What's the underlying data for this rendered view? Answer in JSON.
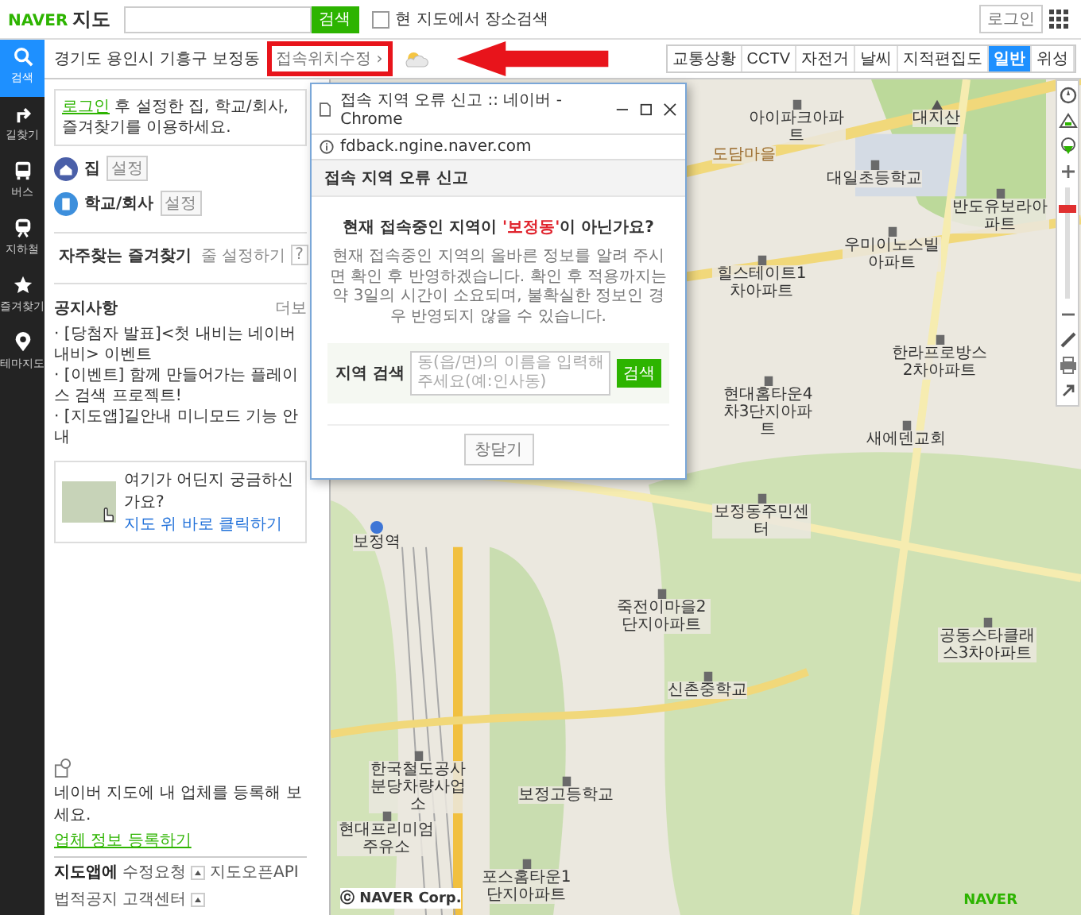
{
  "top_bar": {
    "logo_brand": "NAVER",
    "logo_product": "지도",
    "search_button": "검색",
    "area_search": {
      "label": "현 지도에서 장소검색",
      "checked": false
    },
    "login_button": "로그인"
  },
  "nav": [
    {
      "kind": "search",
      "label": "검색",
      "selected": true
    },
    {
      "kind": "route",
      "label": "길찾기",
      "selected": false
    },
    {
      "kind": "bus",
      "label": "버스",
      "selected": false
    },
    {
      "kind": "subway",
      "label": "지하철",
      "selected": false
    },
    {
      "kind": "star",
      "label": "즐겨찾기",
      "selected": false
    },
    {
      "kind": "pin",
      "label": "테마지도",
      "selected": false
    }
  ],
  "location": {
    "address": "경기도 용인시 기흥구 보정동",
    "fix_link": "접속위치수정 ›"
  },
  "login_notice": {
    "link": "로그인",
    "text": " 후 설정한 집, 학교/회사, 즐겨찾기를 이용하세요."
  },
  "places": [
    {
      "kind": "home",
      "label": "집",
      "action": "설정"
    },
    {
      "kind": "work",
      "label": "학교/회사",
      "action": "설정"
    }
  ],
  "favorites": {
    "title": "자주찾는 즐겨찾기",
    "settings": "줄 설정하기",
    "help": "?"
  },
  "notices": {
    "title": "공지사항",
    "more": "더보",
    "items": [
      "· [당첨자 발표]<첫 내비는 네이버 내비> 이벤트",
      "· [이벤트] 함께 만들어가는 플레이스 검색 프로젝트!",
      "· [지도앱]길안내 미니모드 기능 안내"
    ]
  },
  "promo": {
    "question": "여기가 어딘지 궁금하신가요?",
    "link": "지도 위 바로 클릭하기"
  },
  "business": {
    "text": "네이버 지도에 내 업체를 등록해 보세요.",
    "link": "업체 정보 등록하기"
  },
  "footer": [
    {
      "label": "지도앱에",
      "menu": false
    },
    {
      "label": "수정요청",
      "menu": true
    },
    {
      "label": "지도오픈API",
      "menu": false
    },
    {
      "label": "법적공지",
      "menu": false
    },
    {
      "label": "고객센터",
      "menu": true
    }
  ],
  "layers": [
    {
      "label": "교통상황",
      "selected": false
    },
    {
      "label": "CCTV",
      "selected": false
    },
    {
      "label": "자전거",
      "selected": false
    },
    {
      "label": "날씨",
      "selected": false
    },
    {
      "label": "지적편집도",
      "selected": false
    },
    {
      "label": "일반",
      "selected": true
    },
    {
      "label": "위성",
      "selected": false
    }
  ],
  "map": {
    "zoom": {
      "level": 0.85
    },
    "copyright": "ⓒ NAVER Corp.",
    "logo": "NAVER",
    "labels": [
      {
        "kind": "building",
        "text": "아이파크아파트"
      },
      {
        "kind": "mountain",
        "text": "대지산"
      },
      {
        "kind": "area",
        "text": "도담마을"
      },
      {
        "kind": "building",
        "text": "대일초등학교"
      },
      {
        "kind": "building",
        "text": "반도유보라아파트"
      },
      {
        "kind": "building",
        "text": "우미이노스빌아파트"
      },
      {
        "kind": "building",
        "text": "힐스테이트1차아파트"
      },
      {
        "kind": "building",
        "text": "한라프로방스2차아파트"
      },
      {
        "kind": "building",
        "text": "현대홈타운4차3단지아파트"
      },
      {
        "kind": "building",
        "text": "새에덴교회"
      },
      {
        "kind": "station",
        "text": "보정역"
      },
      {
        "kind": "building",
        "text": "보정동주민센터"
      },
      {
        "kind": "building",
        "text": "죽전이마을2단지아파트"
      },
      {
        "kind": "building",
        "text": "공동스타클래스3차아파트"
      },
      {
        "kind": "building",
        "text": "신촌중학교"
      },
      {
        "kind": "building",
        "text": "한국철도공사 분당차량사업소"
      },
      {
        "kind": "building",
        "text": "보정고등학교"
      },
      {
        "kind": "building",
        "text": "현대프리미엄주유소"
      },
      {
        "kind": "building",
        "text": "포스홈타운1단지아파트"
      }
    ]
  },
  "popup": {
    "title": "접속 지역 오류 신고 :: 네이버 - Chrome",
    "url": "fdback.ngine.naver.com",
    "heading": "접속 지역 오류 신고",
    "question": {
      "before": "현재 접속중인 지역이 ",
      "place": "'보정동'",
      "after": "이 아닌가요?"
    },
    "description": "현재 접속중인 지역의 올바른 정보를 알려 주시면 확인 후 반영하겠습니다. 확인 후 적용까지는 약 3일의 시간이 소요되며, 불확실한 정보인 경우 반영되지 않을 수 있습니다.",
    "search": {
      "label": "지역 검색",
      "placeholder": "동(읍/면)의 이름을 입력해 주세요(예:인사동)",
      "button": "검색"
    },
    "close_button": "창닫기"
  }
}
